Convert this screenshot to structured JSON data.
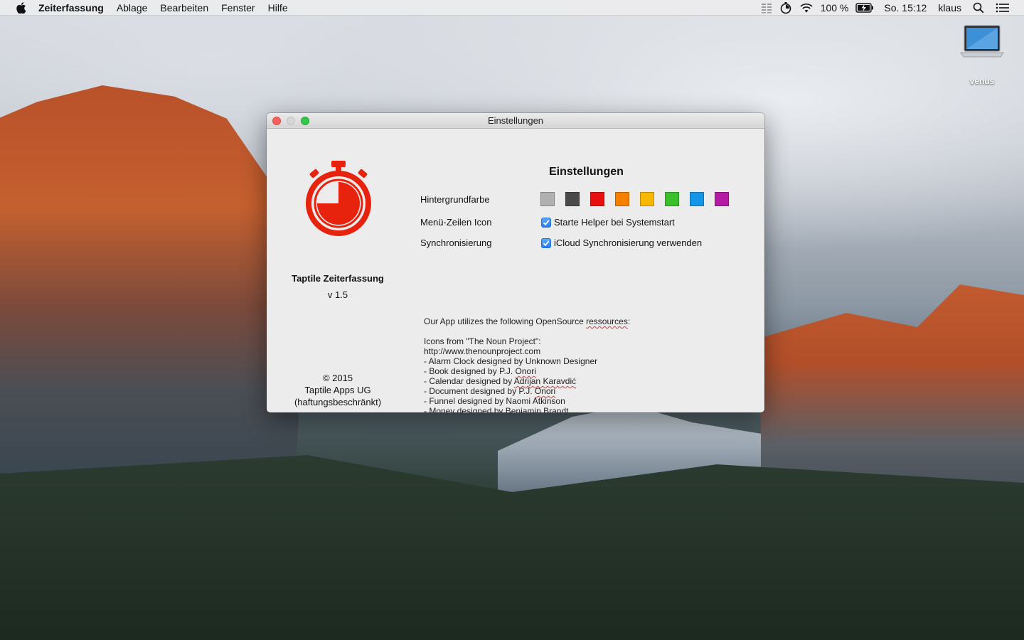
{
  "menubar": {
    "app_name": "Zeiterfassung",
    "menus": [
      "Ablage",
      "Bearbeiten",
      "Fenster",
      "Hilfe"
    ],
    "battery": "100 %",
    "clock": "So. 15:12",
    "user": "klaus",
    "icons": [
      "apple-icon",
      "grid-icon",
      "timer-icon",
      "wifi-icon",
      "battery-charging-icon",
      "search-icon",
      "list-icon"
    ]
  },
  "desktop": {
    "icon_label": "venus"
  },
  "window": {
    "title": "Einstellungen",
    "app_title": "Taptile Zeiterfassung",
    "version": "v 1.5",
    "copyright": [
      "© 2015",
      "Taptile Apps UG",
      "(haftungsbeschränkt)"
    ],
    "heading": "Einstellungen",
    "labels": {
      "background": "Hintergrundfarbe",
      "menu_icon": "Menü-Zeilen Icon",
      "sync": "Synchronisierung"
    },
    "swatches": [
      "#b0b0b0",
      "#4a4a4a",
      "#e8100e",
      "#f77f00",
      "#f9b800",
      "#3bc02c",
      "#1496e8",
      "#b41aa4"
    ],
    "checks": {
      "helper": "Starte Helper bei Systemstart",
      "icloud": "iCloud Synchronisierung verwenden"
    },
    "credits": {
      "intro_a": "Our App utilizes the following OpenSource ",
      "intro_b": "ressources",
      "intro_c": ":",
      "l1": "Icons from \"The Noun Project\":",
      "l2": "http://www.thenounproject.com",
      "l3": "- Alarm Clock designed by Unknown Designer",
      "l4a": "- Book designed by P.J. ",
      "l4b": "Onori",
      "l5a": "- Calendar designed by ",
      "l5b": "Adrijan Karavdić",
      "l6a": "- Document designed by P.J. ",
      "l6b": "Onori",
      "l7": "- Funnel designed by Naomi Atkinson",
      "l8": "- Money designed by Benjamin Brandt"
    }
  }
}
